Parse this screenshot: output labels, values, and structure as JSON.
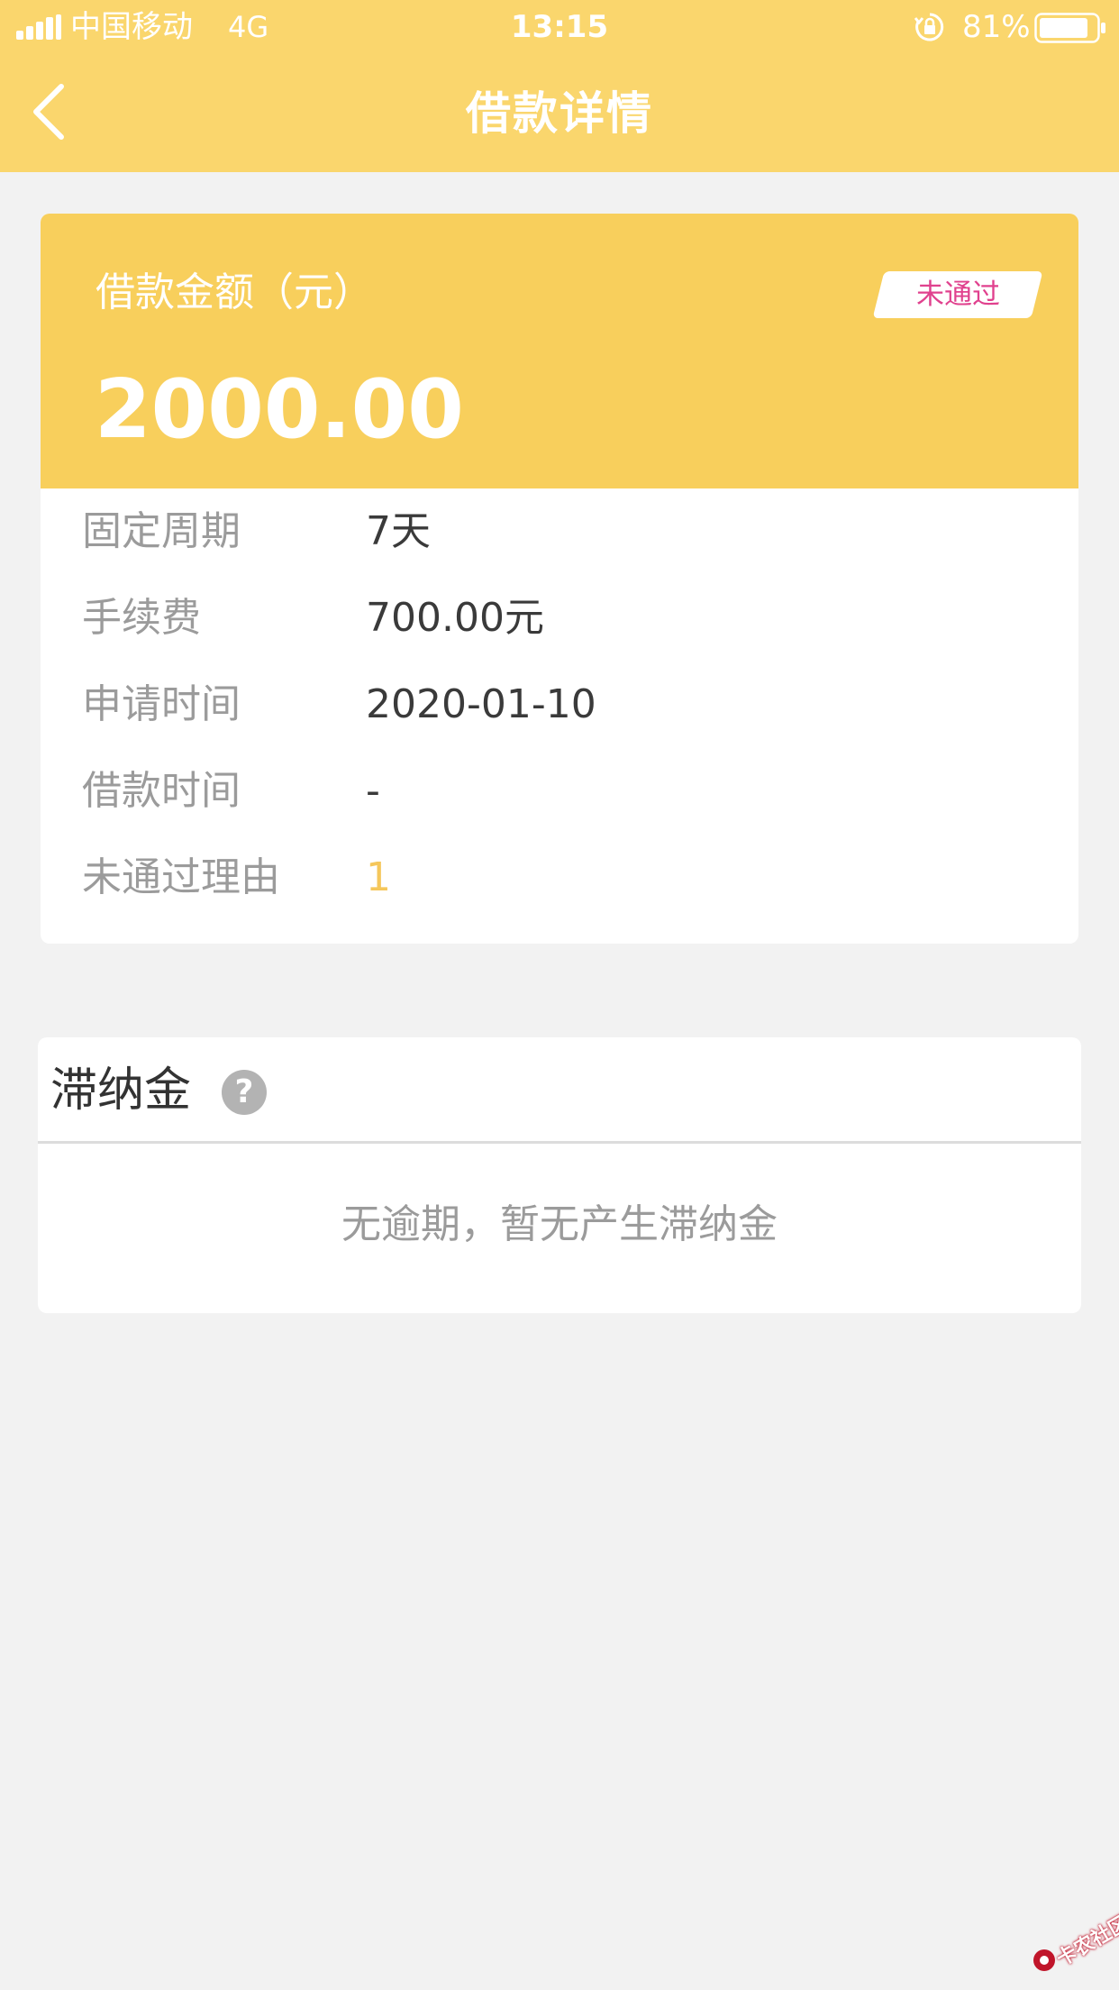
{
  "status_bar": {
    "carrier": "中国移动",
    "network": "4G",
    "time": "13:15",
    "battery_percent": "81%"
  },
  "nav": {
    "title": "借款详情",
    "back_icon": "chevron-left-icon"
  },
  "loan_card": {
    "amount_label": "借款金额（元）",
    "amount": "2000.00",
    "status_badge": "未通过",
    "details": [
      {
        "label": "固定周期",
        "value": "7天"
      },
      {
        "label": "手续费",
        "value": "700.00元"
      },
      {
        "label": "申请时间",
        "value": "2020-01-10"
      },
      {
        "label": "借款时间",
        "value": "-"
      },
      {
        "label": "未通过理由",
        "value": "1"
      }
    ]
  },
  "late_fee": {
    "title": "滞纳金",
    "help_icon": "?",
    "empty_text": "无逾期，暂无产生滞纳金"
  },
  "watermark": {
    "text": "卡农社区"
  },
  "colors": {
    "header_bg": "#fad66d",
    "card_header_bg": "#f8cf5c",
    "page_bg": "#f2f2f2",
    "badge_text": "#e0418e",
    "accent_value": "#f5c75b"
  }
}
